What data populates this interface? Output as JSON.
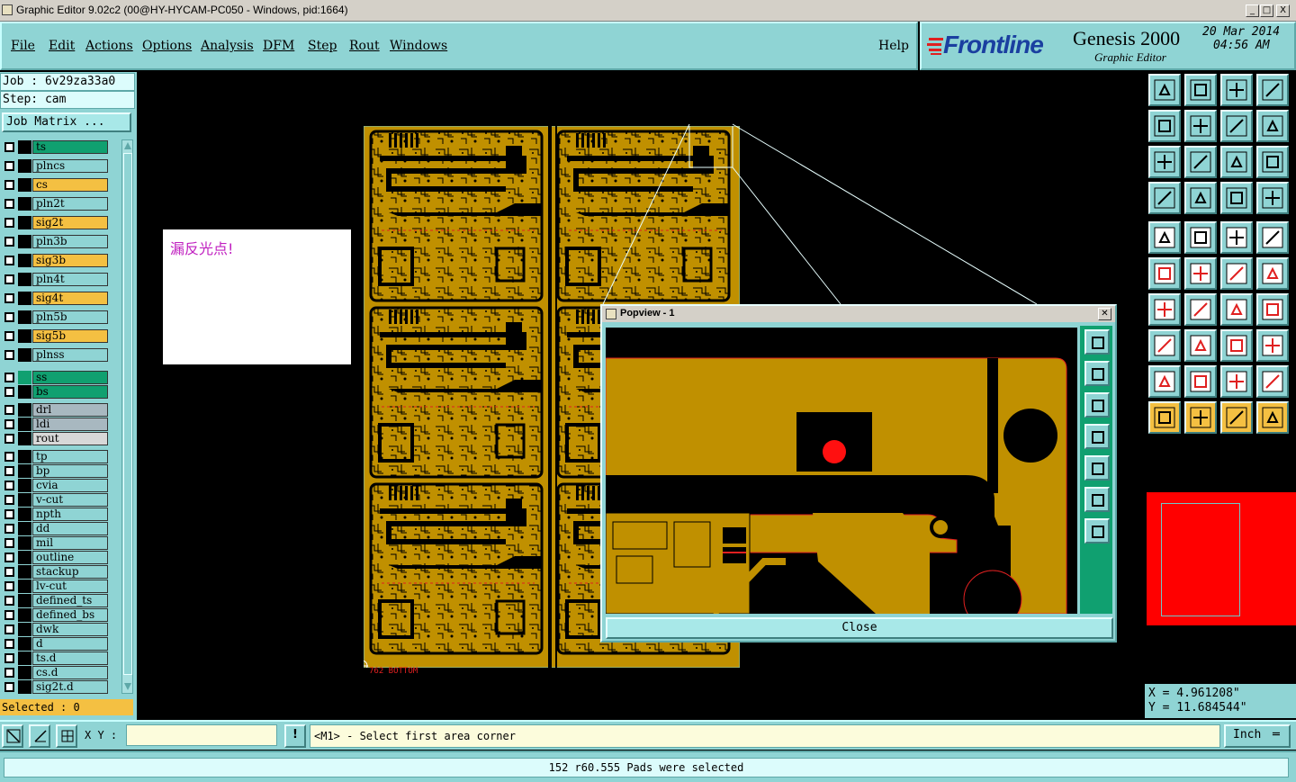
{
  "window": {
    "title": "Graphic Editor 9.02c2 (00@HY-HYCAM-PC050 - Windows, pid:1664)",
    "min": "_",
    "max": "□",
    "close": "X"
  },
  "menu": [
    "File",
    "Edit",
    "Actions",
    "Options",
    "Analysis",
    "DFM",
    "Step",
    "Rout",
    "Windows"
  ],
  "help": "Help",
  "brand": {
    "logo": "Frontline",
    "product": "Genesis 2000",
    "subtitle": "Graphic Editor",
    "date": "20 Mar 2014",
    "time": "04:56 AM"
  },
  "job": {
    "job_line": "Job : 6v29za33a0",
    "step_line": "Step: cam",
    "matrix_button": "Job Matrix ..."
  },
  "layers": [
    {
      "name": "ts",
      "color": "#10a070"
    },
    {
      "name": "plncs",
      "color": "#8fd4d4"
    },
    {
      "name": "cs",
      "color": "#f4c042"
    },
    {
      "name": "pln2t",
      "color": "#8fd4d4"
    },
    {
      "name": "sig2t",
      "color": "#f4c042"
    },
    {
      "name": "pln3b",
      "color": "#8fd4d4"
    },
    {
      "name": "sig3b",
      "color": "#f4c042"
    },
    {
      "name": "pln4t",
      "color": "#8fd4d4"
    },
    {
      "name": "sig4t",
      "color": "#f4c042"
    },
    {
      "name": "pln5b",
      "color": "#8fd4d4"
    },
    {
      "name": "sig5b",
      "color": "#f4c042"
    },
    {
      "name": "plnss",
      "color": "#8fd4d4"
    },
    {
      "name": "ss",
      "color": "#10a070"
    },
    {
      "name": "bs",
      "color": "#10a070"
    },
    {
      "name": "drl",
      "color": "#a8b8c0"
    },
    {
      "name": "ldi",
      "color": "#a8b8c0"
    },
    {
      "name": "rout",
      "color": "#d8d8d8"
    },
    {
      "name": "tp",
      "color": "#8fd4d4"
    },
    {
      "name": "bp",
      "color": "#8fd4d4"
    },
    {
      "name": "cvia",
      "color": "#8fd4d4"
    },
    {
      "name": "v-cut",
      "color": "#8fd4d4"
    },
    {
      "name": "npth",
      "color": "#8fd4d4"
    },
    {
      "name": "dd",
      "color": "#8fd4d4"
    },
    {
      "name": "mil",
      "color": "#8fd4d4"
    },
    {
      "name": "outline",
      "color": "#8fd4d4"
    },
    {
      "name": "stackup",
      "color": "#8fd4d4"
    },
    {
      "name": "lv-cut",
      "color": "#8fd4d4"
    },
    {
      "name": "defined_ts",
      "color": "#8fd4d4"
    },
    {
      "name": "defined_bs",
      "color": "#8fd4d4"
    },
    {
      "name": "dwk",
      "color": "#8fd4d4"
    },
    {
      "name": "d",
      "color": "#8fd4d4"
    },
    {
      "name": "ts.d",
      "color": "#8fd4d4"
    },
    {
      "name": "cs.d",
      "color": "#8fd4d4"
    },
    {
      "name": "sig2t.d",
      "color": "#8fd4d4"
    }
  ],
  "selected": "Selected : 0",
  "note": "漏反光点!",
  "board_label": "762  BOTTOM",
  "popview": {
    "title": "Popview - 1",
    "close": "Close"
  },
  "coords": {
    "x": "X = 4.961208\"",
    "y": "Y = 11.684544\""
  },
  "bottom": {
    "xy_label": "X Y :",
    "xy_value": "",
    "message": "<M1> - Select first area corner",
    "units": "Inch"
  },
  "status": "152 r60.555 Pads were selected",
  "colors": {
    "panel": "#8fd4d4",
    "copper": "#c09000",
    "highlight": "#ff0000",
    "accent_yellow": "#f4c042"
  }
}
